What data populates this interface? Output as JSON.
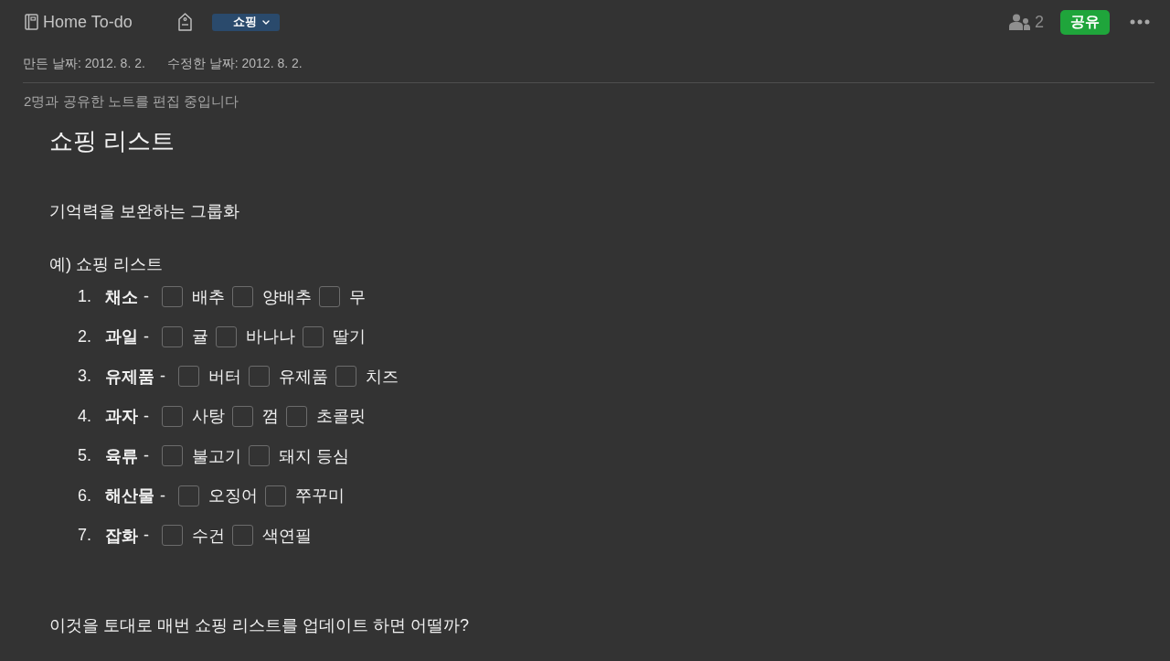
{
  "header": {
    "notebook_title": "Home To-do",
    "tag": {
      "label": "쇼핑"
    },
    "collaborator_count": "2",
    "share_button": "공유"
  },
  "meta": {
    "created": "만든 날짜: 2012. 8. 2.",
    "modified": "수정한 날짜: 2012. 8. 2."
  },
  "sharing_notice": "2명과 공유한 노트를 편집 중입니다",
  "note": {
    "title": "쇼핑 리스트",
    "intro": "기억력을 보완하는 그룹화",
    "example_label": "예) 쇼핑 리스트",
    "list": [
      {
        "number": "1.",
        "category": "채소",
        "separator": "-",
        "entries": [
          {
            "label": "배추",
            "checked": false
          },
          {
            "label": "양배추",
            "checked": false
          },
          {
            "label": "무",
            "checked": false
          }
        ]
      },
      {
        "number": "2.",
        "category": "과일",
        "separator": "-",
        "entries": [
          {
            "label": "귤",
            "checked": false
          },
          {
            "label": "바나나",
            "checked": false
          },
          {
            "label": "딸기",
            "checked": false
          }
        ]
      },
      {
        "number": "3.",
        "category": "유제품",
        "separator": "-",
        "entries": [
          {
            "label": "버터",
            "checked": false
          },
          {
            "label": "유제품",
            "checked": false
          },
          {
            "label": "치즈",
            "checked": false
          }
        ]
      },
      {
        "number": "4.",
        "category": "과자",
        "separator": "-",
        "entries": [
          {
            "label": "사탕",
            "checked": false
          },
          {
            "label": "껌",
            "checked": false
          },
          {
            "label": "초콜릿",
            "checked": false
          }
        ]
      },
      {
        "number": "5.",
        "category": "육류",
        "separator": "-",
        "entries": [
          {
            "label": "불고기",
            "checked": false
          },
          {
            "label": "돼지 등심",
            "checked": false
          }
        ]
      },
      {
        "number": "6.",
        "category": "해산물",
        "separator": "-",
        "entries": [
          {
            "label": "오징어",
            "checked": false
          },
          {
            "label": "쭈꾸미",
            "checked": false
          }
        ]
      },
      {
        "number": "7.",
        "category": "잡화",
        "separator": "-",
        "entries": [
          {
            "label": "수건",
            "checked": false
          },
          {
            "label": "색연필",
            "checked": false
          }
        ]
      }
    ],
    "closing": "이것을 토대로 매번 쇼핑 리스트를 업데이트 하면 어떨까?"
  }
}
